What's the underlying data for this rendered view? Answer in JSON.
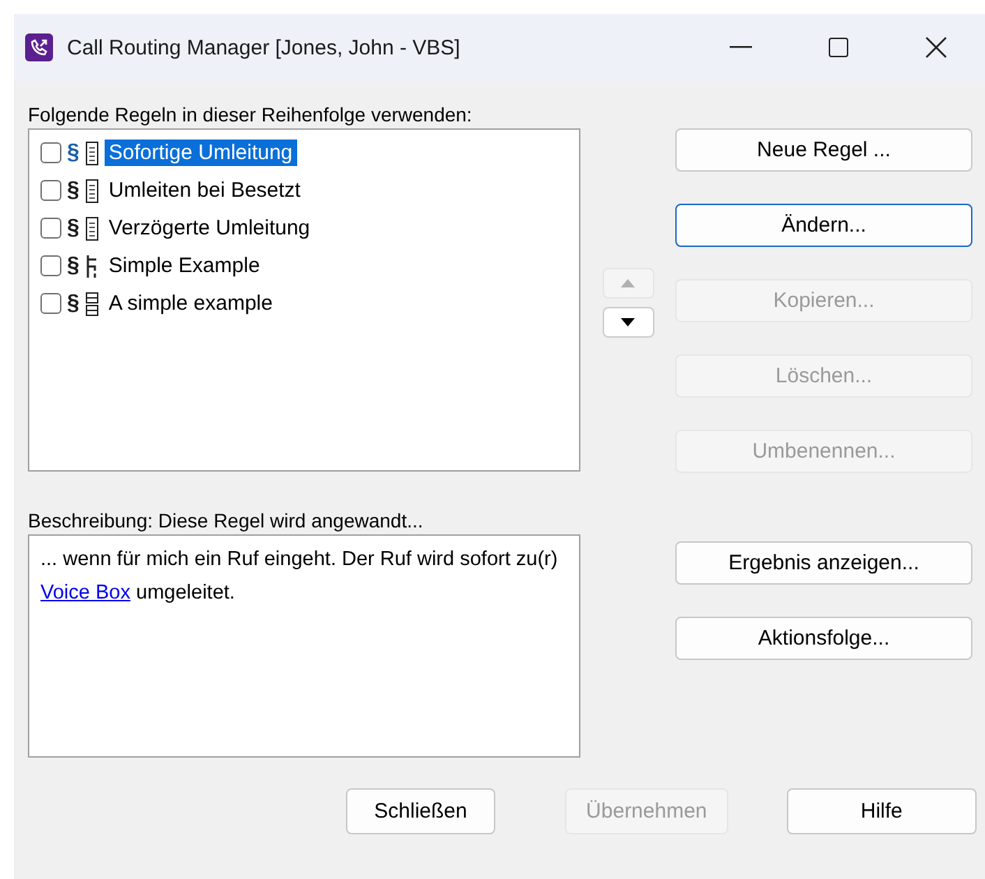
{
  "window": {
    "title": "Call Routing Manager [Jones, John - VBS]"
  },
  "rules_label": "Folgende Regeln in dieser Reihenfolge verwenden:",
  "rules": [
    {
      "symbol": "§",
      "kind": "list",
      "label": "Sofortige Umleitung",
      "checked": false,
      "selected": true
    },
    {
      "symbol": "§",
      "kind": "list",
      "label": "Umleiten bei Besetzt",
      "checked": false,
      "selected": false
    },
    {
      "symbol": "§",
      "kind": "list",
      "label": "Verzögerte Umleitung",
      "checked": false,
      "selected": false
    },
    {
      "symbol": "§",
      "kind": "branch",
      "label": "Simple Example",
      "checked": false,
      "selected": false
    },
    {
      "symbol": "§",
      "kind": "grid",
      "label": "A simple example",
      "checked": false,
      "selected": false
    }
  ],
  "move_buttons": [
    {
      "kind": "up",
      "disabled": true
    },
    {
      "kind": "down",
      "disabled": false
    }
  ],
  "rule_buttons": [
    {
      "label": "Neue Regel ...",
      "disabled": false,
      "focused": false
    },
    {
      "label": "Ändern...",
      "disabled": false,
      "focused": true
    },
    {
      "label": "Kopieren...",
      "disabled": true,
      "focused": false
    },
    {
      "label": "Löschen...",
      "disabled": true,
      "focused": false
    },
    {
      "label": "Umbenennen...",
      "disabled": true,
      "focused": false
    }
  ],
  "description_label": "Beschreibung: Diese Regel wird angewandt...",
  "description": {
    "text_before": "... wenn für mich ein Ruf eingeht. Der Ruf wird sofort zu(r) ",
    "link": "Voice Box",
    "text_after": " umgeleitet."
  },
  "description_buttons": [
    {
      "label": "Ergebnis anzeigen...",
      "disabled": false
    },
    {
      "label": "Aktionsfolge...",
      "disabled": false
    }
  ],
  "footer_buttons": [
    {
      "label": "Schließen",
      "disabled": false
    },
    {
      "label": "Übernehmen",
      "disabled": true
    },
    {
      "label": "Hilfe",
      "disabled": false
    }
  ]
}
